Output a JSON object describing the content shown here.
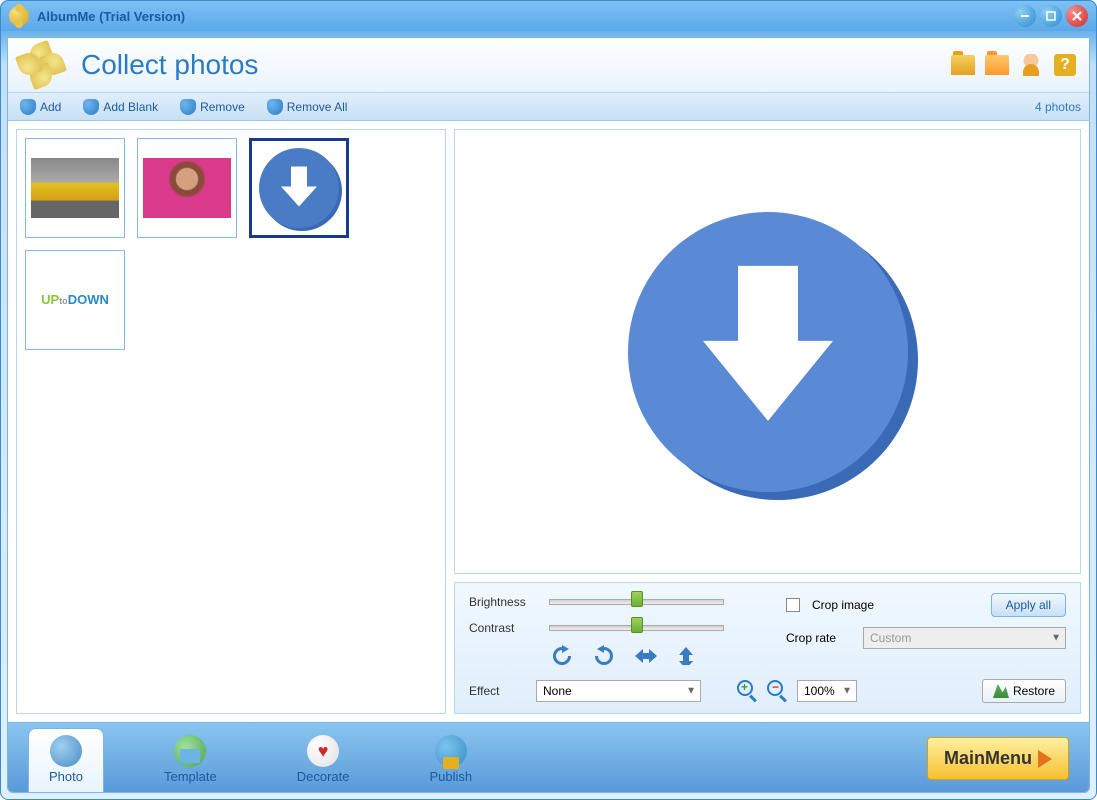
{
  "window": {
    "title": "AlbumMe (Trial Version)"
  },
  "header": {
    "title": "Collect photos"
  },
  "toolbar": {
    "add": "Add",
    "add_blank": "Add Blank",
    "remove": "Remove",
    "remove_all": "Remove All",
    "photo_count": "4 photos"
  },
  "controls": {
    "brightness_label": "Brightness",
    "contrast_label": "Contrast",
    "crop_image_label": "Crop image",
    "apply_all": "Apply all",
    "crop_rate_label": "Crop rate",
    "crop_rate_value": "Custom",
    "effect_label": "Effect",
    "effect_value": "None",
    "zoom_value": "100%",
    "restore": "Restore"
  },
  "tabs": {
    "photo": "Photo",
    "template": "Template",
    "decorate": "Decorate",
    "publish": "Publish"
  },
  "main_menu": "MainMenu"
}
